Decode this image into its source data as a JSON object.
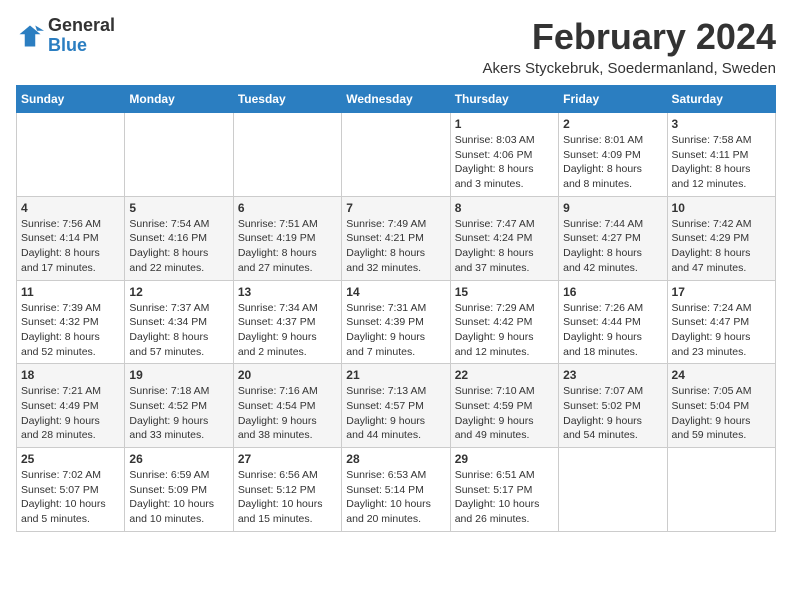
{
  "header": {
    "logo_general": "General",
    "logo_blue": "Blue",
    "title": "February 2024",
    "subtitle": "Akers Styckebruk, Soedermanland, Sweden"
  },
  "weekdays": [
    "Sunday",
    "Monday",
    "Tuesday",
    "Wednesday",
    "Thursday",
    "Friday",
    "Saturday"
  ],
  "weeks": [
    [
      {
        "day": "",
        "info": ""
      },
      {
        "day": "",
        "info": ""
      },
      {
        "day": "",
        "info": ""
      },
      {
        "day": "",
        "info": ""
      },
      {
        "day": "1",
        "info": "Sunrise: 8:03 AM\nSunset: 4:06 PM\nDaylight: 8 hours\nand 3 minutes."
      },
      {
        "day": "2",
        "info": "Sunrise: 8:01 AM\nSunset: 4:09 PM\nDaylight: 8 hours\nand 8 minutes."
      },
      {
        "day": "3",
        "info": "Sunrise: 7:58 AM\nSunset: 4:11 PM\nDaylight: 8 hours\nand 12 minutes."
      }
    ],
    [
      {
        "day": "4",
        "info": "Sunrise: 7:56 AM\nSunset: 4:14 PM\nDaylight: 8 hours\nand 17 minutes."
      },
      {
        "day": "5",
        "info": "Sunrise: 7:54 AM\nSunset: 4:16 PM\nDaylight: 8 hours\nand 22 minutes."
      },
      {
        "day": "6",
        "info": "Sunrise: 7:51 AM\nSunset: 4:19 PM\nDaylight: 8 hours\nand 27 minutes."
      },
      {
        "day": "7",
        "info": "Sunrise: 7:49 AM\nSunset: 4:21 PM\nDaylight: 8 hours\nand 32 minutes."
      },
      {
        "day": "8",
        "info": "Sunrise: 7:47 AM\nSunset: 4:24 PM\nDaylight: 8 hours\nand 37 minutes."
      },
      {
        "day": "9",
        "info": "Sunrise: 7:44 AM\nSunset: 4:27 PM\nDaylight: 8 hours\nand 42 minutes."
      },
      {
        "day": "10",
        "info": "Sunrise: 7:42 AM\nSunset: 4:29 PM\nDaylight: 8 hours\nand 47 minutes."
      }
    ],
    [
      {
        "day": "11",
        "info": "Sunrise: 7:39 AM\nSunset: 4:32 PM\nDaylight: 8 hours\nand 52 minutes."
      },
      {
        "day": "12",
        "info": "Sunrise: 7:37 AM\nSunset: 4:34 PM\nDaylight: 8 hours\nand 57 minutes."
      },
      {
        "day": "13",
        "info": "Sunrise: 7:34 AM\nSunset: 4:37 PM\nDaylight: 9 hours\nand 2 minutes."
      },
      {
        "day": "14",
        "info": "Sunrise: 7:31 AM\nSunset: 4:39 PM\nDaylight: 9 hours\nand 7 minutes."
      },
      {
        "day": "15",
        "info": "Sunrise: 7:29 AM\nSunset: 4:42 PM\nDaylight: 9 hours\nand 12 minutes."
      },
      {
        "day": "16",
        "info": "Sunrise: 7:26 AM\nSunset: 4:44 PM\nDaylight: 9 hours\nand 18 minutes."
      },
      {
        "day": "17",
        "info": "Sunrise: 7:24 AM\nSunset: 4:47 PM\nDaylight: 9 hours\nand 23 minutes."
      }
    ],
    [
      {
        "day": "18",
        "info": "Sunrise: 7:21 AM\nSunset: 4:49 PM\nDaylight: 9 hours\nand 28 minutes."
      },
      {
        "day": "19",
        "info": "Sunrise: 7:18 AM\nSunset: 4:52 PM\nDaylight: 9 hours\nand 33 minutes."
      },
      {
        "day": "20",
        "info": "Sunrise: 7:16 AM\nSunset: 4:54 PM\nDaylight: 9 hours\nand 38 minutes."
      },
      {
        "day": "21",
        "info": "Sunrise: 7:13 AM\nSunset: 4:57 PM\nDaylight: 9 hours\nand 44 minutes."
      },
      {
        "day": "22",
        "info": "Sunrise: 7:10 AM\nSunset: 4:59 PM\nDaylight: 9 hours\nand 49 minutes."
      },
      {
        "day": "23",
        "info": "Sunrise: 7:07 AM\nSunset: 5:02 PM\nDaylight: 9 hours\nand 54 minutes."
      },
      {
        "day": "24",
        "info": "Sunrise: 7:05 AM\nSunset: 5:04 PM\nDaylight: 9 hours\nand 59 minutes."
      }
    ],
    [
      {
        "day": "25",
        "info": "Sunrise: 7:02 AM\nSunset: 5:07 PM\nDaylight: 10 hours\nand 5 minutes."
      },
      {
        "day": "26",
        "info": "Sunrise: 6:59 AM\nSunset: 5:09 PM\nDaylight: 10 hours\nand 10 minutes."
      },
      {
        "day": "27",
        "info": "Sunrise: 6:56 AM\nSunset: 5:12 PM\nDaylight: 10 hours\nand 15 minutes."
      },
      {
        "day": "28",
        "info": "Sunrise: 6:53 AM\nSunset: 5:14 PM\nDaylight: 10 hours\nand 20 minutes."
      },
      {
        "day": "29",
        "info": "Sunrise: 6:51 AM\nSunset: 5:17 PM\nDaylight: 10 hours\nand 26 minutes."
      },
      {
        "day": "",
        "info": ""
      },
      {
        "day": "",
        "info": ""
      }
    ]
  ]
}
